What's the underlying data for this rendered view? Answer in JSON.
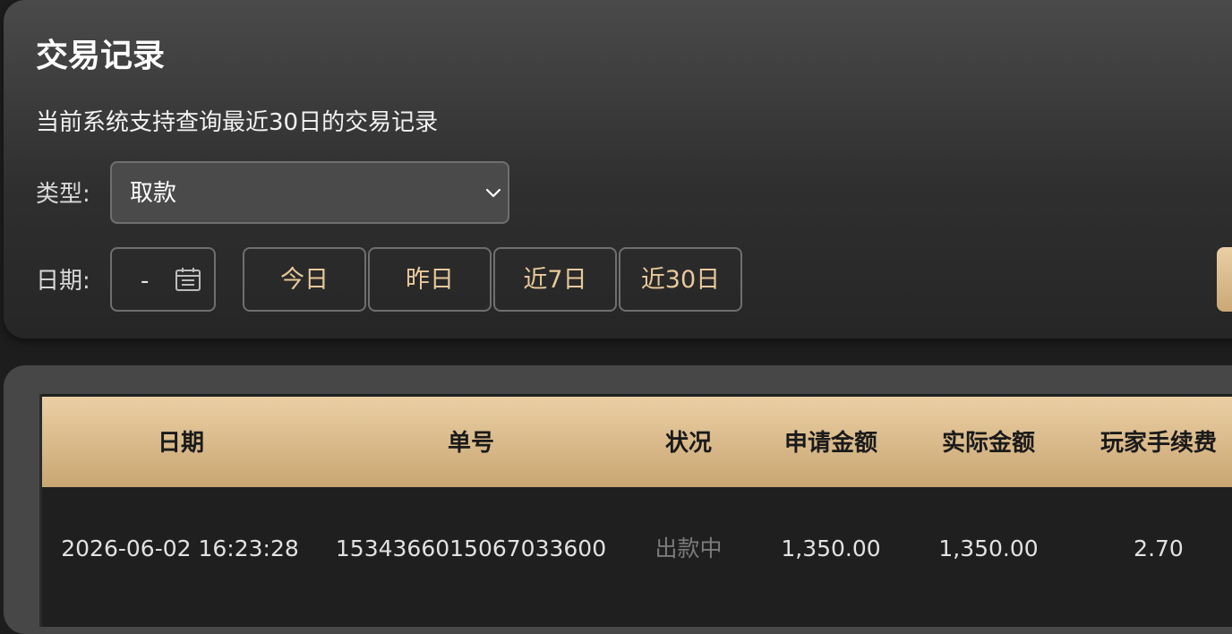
{
  "header": {
    "title": "交易记录",
    "subtitle": "当前系统支持查询最近30日的交易记录"
  },
  "filters": {
    "type_label": "类型:",
    "type_value": "取款",
    "date_label": "日期:",
    "date_range_separator": "-",
    "quick_ranges": [
      "今日",
      "昨日",
      "近7日",
      "近30日"
    ]
  },
  "icons": {
    "dropdown": "chevron-down-icon",
    "calendar": "calendar-icon"
  },
  "colors": {
    "accent_gold": "#e8c99a",
    "header_gradient_top": "#ebcfa4",
    "header_gradient_bottom": "#c9a673",
    "status_pending": "#7a7a7a"
  },
  "table": {
    "columns": [
      "日期",
      "单号",
      "状况",
      "申请金额",
      "实际金额",
      "玩家手续费"
    ],
    "rows": [
      {
        "date": "2026-06-02 16:23:28",
        "order_no": "1534366015067033600",
        "status": "出款中",
        "requested_amount": "1,350.00",
        "actual_amount": "1,350.00",
        "player_fee": "2.70"
      }
    ]
  }
}
